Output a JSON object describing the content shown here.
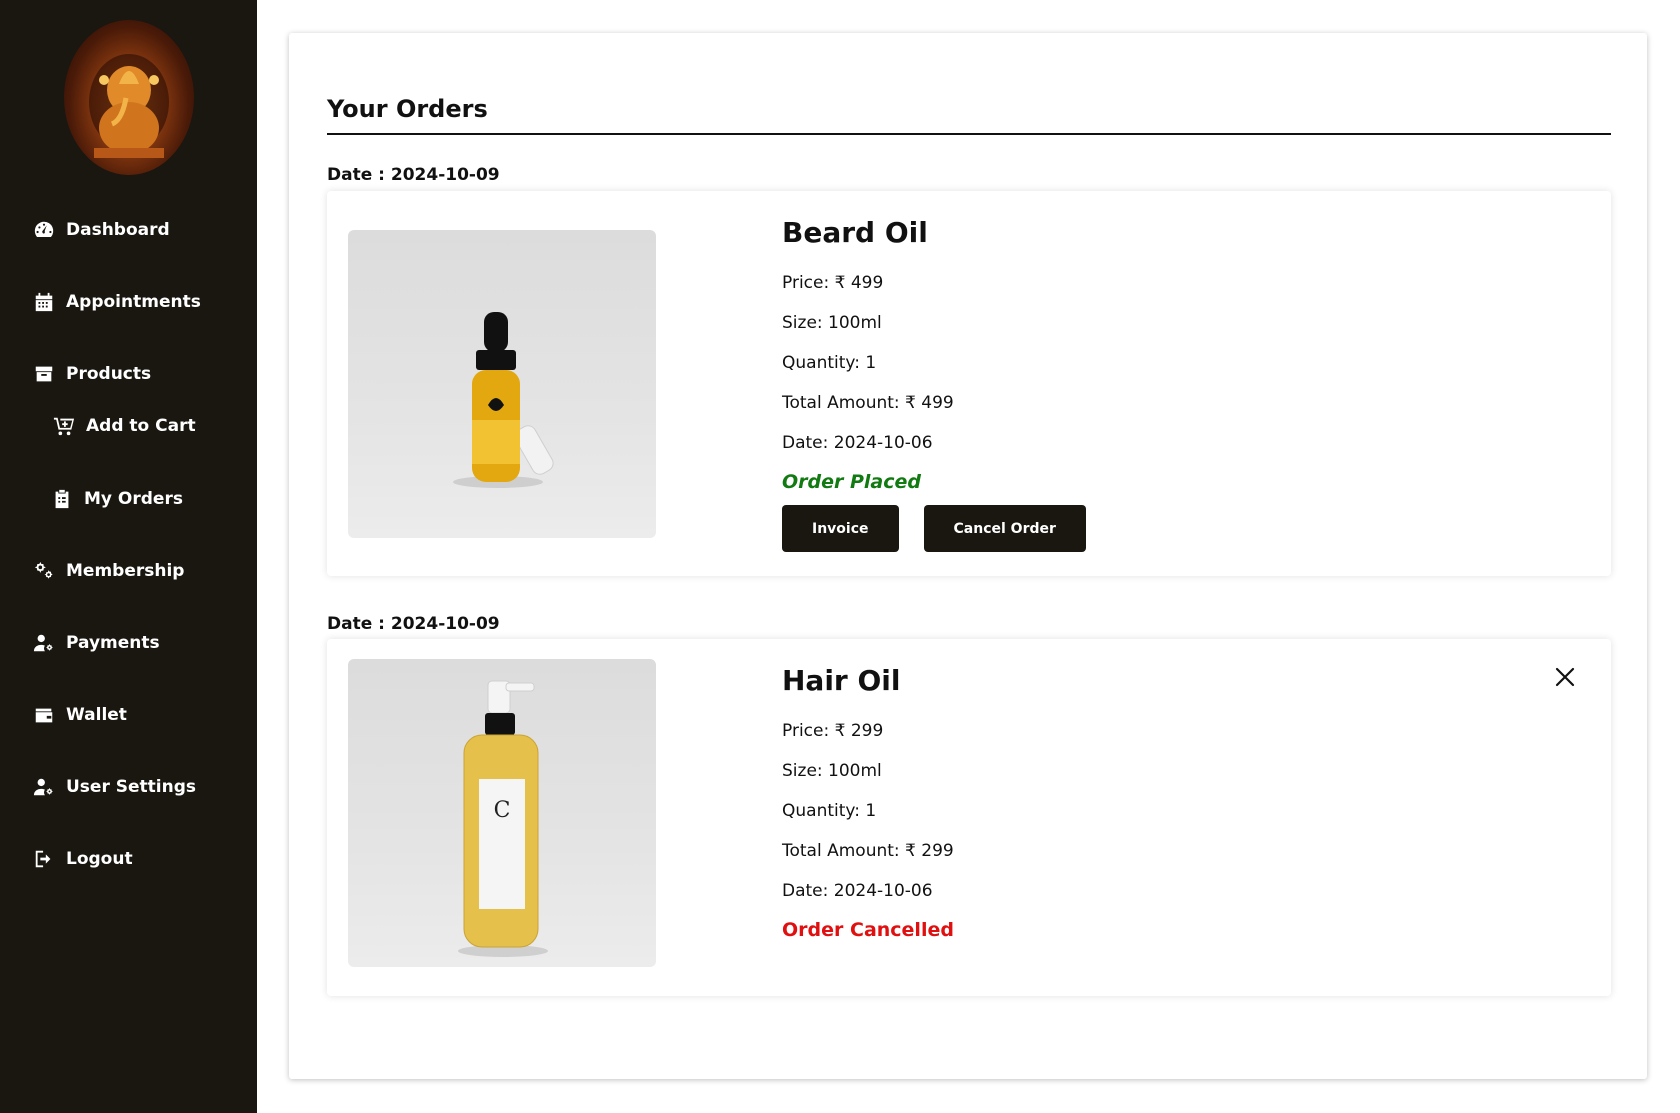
{
  "sidebar": {
    "items": [
      {
        "label": "Dashboard",
        "icon": "dashboard-icon"
      },
      {
        "label": "Appointments",
        "icon": "calendar-icon"
      },
      {
        "label": "Products",
        "icon": "box-icon"
      },
      {
        "label": "Add to Cart",
        "icon": "cart-icon"
      },
      {
        "label": "My Orders",
        "icon": "clipboard-icon"
      },
      {
        "label": "Membership",
        "icon": "gears-icon"
      },
      {
        "label": "Payments",
        "icon": "user-gear-icon"
      },
      {
        "label": "Wallet",
        "icon": "wallet-icon"
      },
      {
        "label": "User Settings",
        "icon": "user-gear-icon"
      },
      {
        "label": "Logout",
        "icon": "logout-icon"
      }
    ]
  },
  "main": {
    "title": "Your Orders",
    "orders": [
      {
        "date_label": "Date : 2024-10-09",
        "name": "Beard Oil",
        "price": "Price: ₹ 499",
        "size": "Size: 100ml",
        "quantity": "Quantity: 1",
        "total": "Total Amount: ₹ 499",
        "date": "Date: 2024-10-06",
        "status": "Order Placed",
        "status_color": "#117a11",
        "invoice_label": "Invoice",
        "cancel_label": "Cancel Order"
      },
      {
        "date_label": "Date : 2024-10-09",
        "name": "Hair Oil",
        "price": "Price: ₹ 299",
        "size": "Size: 100ml",
        "quantity": "Quantity: 1",
        "total": "Total Amount: ₹ 299",
        "date": "Date: 2024-10-06",
        "status": "Order Cancelled",
        "status_color": "#e01010"
      }
    ]
  },
  "colors": {
    "sidebar_bg": "#1a1610",
    "button_bg": "#1a1610"
  }
}
